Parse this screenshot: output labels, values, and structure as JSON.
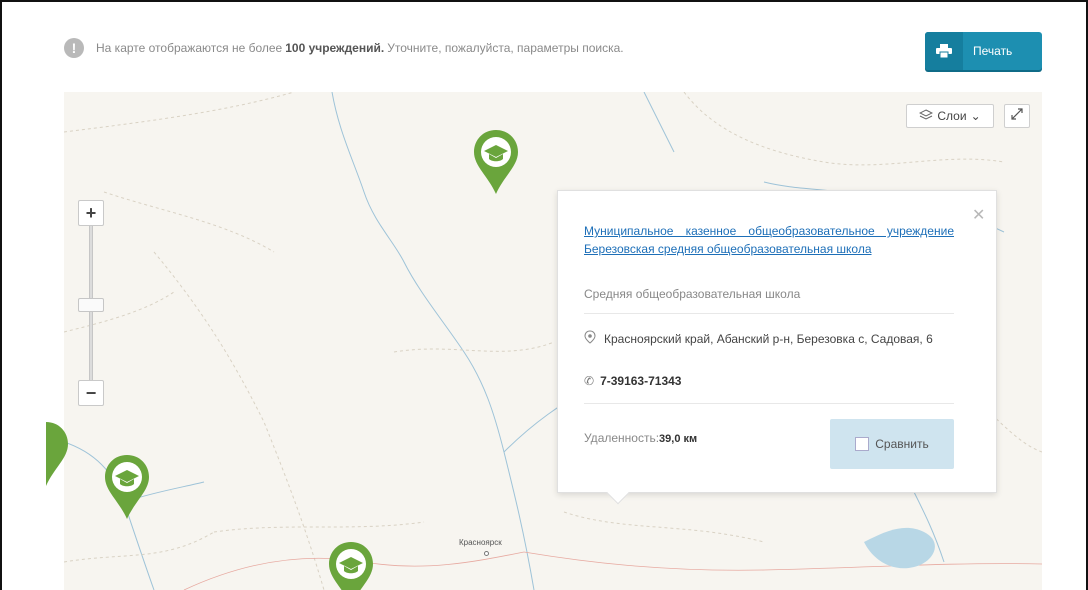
{
  "notice": {
    "icon": "info-icon",
    "text_before": "На карте отображаются не более",
    "text_bold": "100 учреждений.",
    "text_after": "Уточните, пожалуйста, параметры поиска."
  },
  "print_button": {
    "label": "Печать",
    "icon": "printer-icon",
    "color": "#1d8fb1"
  },
  "map_controls": {
    "layers_label": "Слои",
    "layers_icon": "layers-icon",
    "fullscreen_icon": "expand-icon",
    "zoom_in_label": "+",
    "zoom_out_label": "−"
  },
  "map": {
    "city_label": "Красноярск",
    "pin_color": "#6aa53c",
    "pin_icon": "graduation-cap-icon"
  },
  "popup": {
    "title": "Муниципальное казенное общеобразовательное учреждение Березовская средняя общеобразовательная школа",
    "type": "Средняя общеобразовательная школа",
    "address": "Красноярский край, Абанский р-н, Березовка с, Садовая, 6",
    "phone": "7-39163-71343",
    "distance_label": "Удаленность:",
    "distance_value": "39,0 км",
    "compare_label": "Сравнить",
    "close_icon": "close-icon"
  }
}
